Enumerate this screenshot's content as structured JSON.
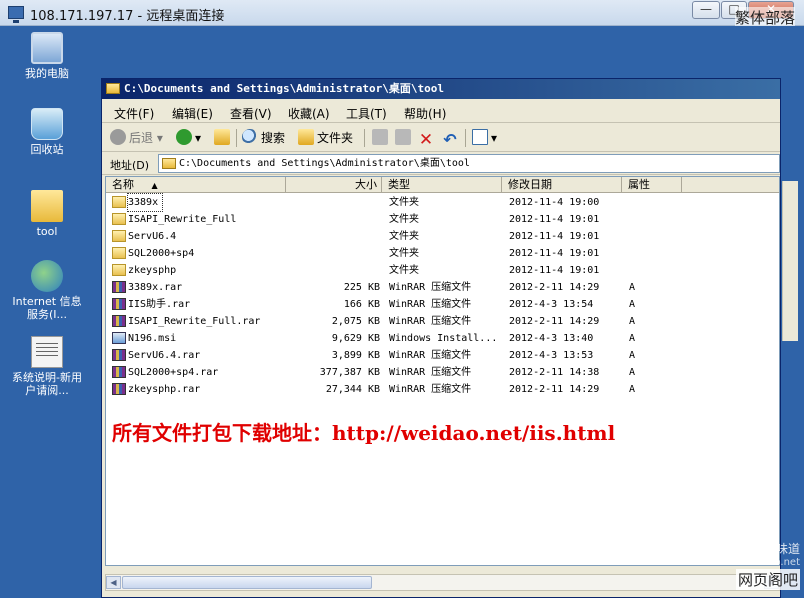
{
  "rdp": {
    "title": "108.171.197.17 - 远程桌面连接",
    "min_label": "—",
    "max_label": "□",
    "close_label": "✕"
  },
  "watermark": {
    "top": "繁体部落",
    "bottom_line1": "@ 味道",
    "bottom_line2": "weidao.net",
    "bottom_line3": "网页阁吧"
  },
  "desktop": {
    "icons": [
      {
        "label": "我的电脑",
        "icon": "computer-icon"
      },
      {
        "label": "回收站",
        "icon": "recycle-bin-icon"
      },
      {
        "label": "tool",
        "icon": "folder-icon"
      },
      {
        "label": "Internet 信息服务(I...",
        "icon": "iis-icon"
      },
      {
        "label": "系统说明-新用户请阅...",
        "icon": "document-icon"
      }
    ]
  },
  "explorer": {
    "title": "C:\\Documents and Settings\\Administrator\\桌面\\tool",
    "menu": [
      "文件(F)",
      "编辑(E)",
      "查看(V)",
      "收藏(A)",
      "工具(T)",
      "帮助(H)"
    ],
    "toolbar": {
      "back": "后退",
      "search": "搜索",
      "folders": "文件夹"
    },
    "address": {
      "label": "地址(D)",
      "value": "C:\\Documents and Settings\\Administrator\\桌面\\tool"
    },
    "columns": {
      "name": "名称",
      "size": "大小",
      "type": "类型",
      "date": "修改日期",
      "attr": "属性"
    },
    "files": [
      {
        "name": "3389x",
        "size": "",
        "type": "文件夹",
        "date": "2012-11-4 19:00",
        "attr": "",
        "kind": "folder"
      },
      {
        "name": "ISAPI_Rewrite_Full",
        "size": "",
        "type": "文件夹",
        "date": "2012-11-4 19:01",
        "attr": "",
        "kind": "folder"
      },
      {
        "name": "ServU6.4",
        "size": "",
        "type": "文件夹",
        "date": "2012-11-4 19:01",
        "attr": "",
        "kind": "folder"
      },
      {
        "name": "SQL2000+sp4",
        "size": "",
        "type": "文件夹",
        "date": "2012-11-4 19:01",
        "attr": "",
        "kind": "folder"
      },
      {
        "name": "zkeysphp",
        "size": "",
        "type": "文件夹",
        "date": "2012-11-4 19:01",
        "attr": "",
        "kind": "folder"
      },
      {
        "name": "3389x.rar",
        "size": "225 KB",
        "type": "WinRAR 压缩文件",
        "date": "2012-2-11 14:29",
        "attr": "A",
        "kind": "rar"
      },
      {
        "name": "IIS助手.rar",
        "size": "166 KB",
        "type": "WinRAR 压缩文件",
        "date": "2012-4-3 13:54",
        "attr": "A",
        "kind": "rar"
      },
      {
        "name": "ISAPI_Rewrite_Full.rar",
        "size": "2,075 KB",
        "type": "WinRAR 压缩文件",
        "date": "2012-2-11 14:29",
        "attr": "A",
        "kind": "rar"
      },
      {
        "name": "N196.msi",
        "size": "9,629 KB",
        "type": "Windows Install...",
        "date": "2012-4-3 13:40",
        "attr": "A",
        "kind": "msi"
      },
      {
        "name": "ServU6.4.rar",
        "size": "3,899 KB",
        "type": "WinRAR 压缩文件",
        "date": "2012-4-3 13:53",
        "attr": "A",
        "kind": "rar"
      },
      {
        "name": "SQL2000+sp4.rar",
        "size": "377,387 KB",
        "type": "WinRAR 压缩文件",
        "date": "2012-2-11 14:38",
        "attr": "A",
        "kind": "rar"
      },
      {
        "name": "zkeysphp.rar",
        "size": "27,344 KB",
        "type": "WinRAR 压缩文件",
        "date": "2012-2-11 14:29",
        "attr": "A",
        "kind": "rar"
      }
    ],
    "download_text": "所有文件打包下载地址：http://weidao.net/iis.html"
  }
}
